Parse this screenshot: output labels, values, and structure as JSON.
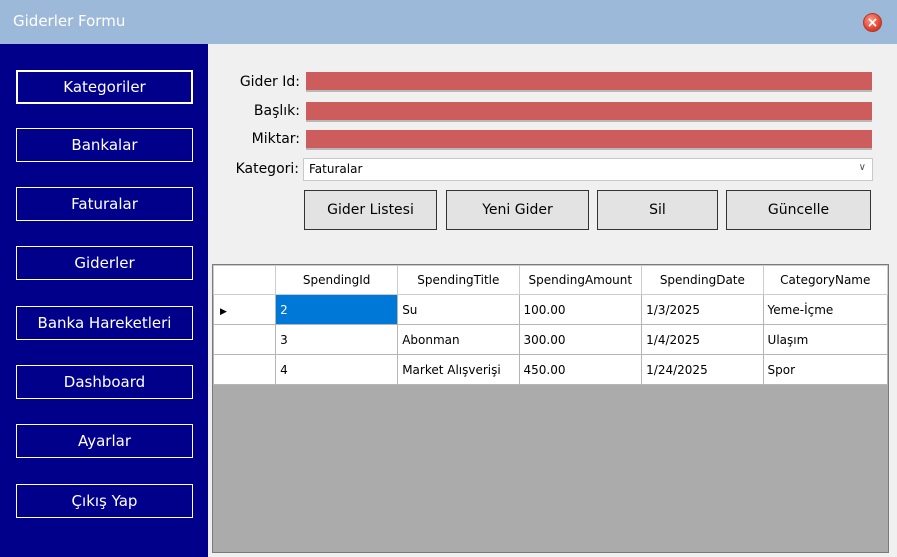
{
  "window": {
    "title": "Giderler Formu"
  },
  "sidebar": {
    "items": [
      {
        "label": "Kategoriler"
      },
      {
        "label": "Bankalar"
      },
      {
        "label": "Faturalar"
      },
      {
        "label": "Giderler"
      },
      {
        "label": "Banka Hareketleri"
      },
      {
        "label": "Dashboard"
      },
      {
        "label": "Ayarlar"
      },
      {
        "label": "Çıkış Yap"
      }
    ]
  },
  "form": {
    "id_label": "Gider Id:",
    "title_label": "Başlık:",
    "amount_label": "Miktar:",
    "category_label": "Kategori:",
    "category_value": "Faturalar",
    "field_color": "#cd5c5c"
  },
  "actions": {
    "list": "Gider Listesi",
    "new": "Yeni Gider",
    "delete": "Sil",
    "update": "Güncelle"
  },
  "grid": {
    "columns": [
      "SpendingId",
      "SpendingTitle",
      "SpendingAmount",
      "SpendingDate",
      "CategoryName"
    ],
    "rows": [
      [
        "2",
        "Su",
        "100.00",
        "1/3/2025",
        "Yeme-İçme"
      ],
      [
        "3",
        "Abonman",
        "300.00",
        "1/4/2025",
        "Ulaşım"
      ],
      [
        "4",
        "Market Alışverişi",
        "450.00",
        "1/24/2025",
        "Spor"
      ]
    ],
    "current_row_marker": "▶"
  },
  "colors": {
    "sidebar": "#00008b",
    "titlebar": "#9db9d9",
    "selection": "#0078d7",
    "grid_bg": "#ababab"
  }
}
